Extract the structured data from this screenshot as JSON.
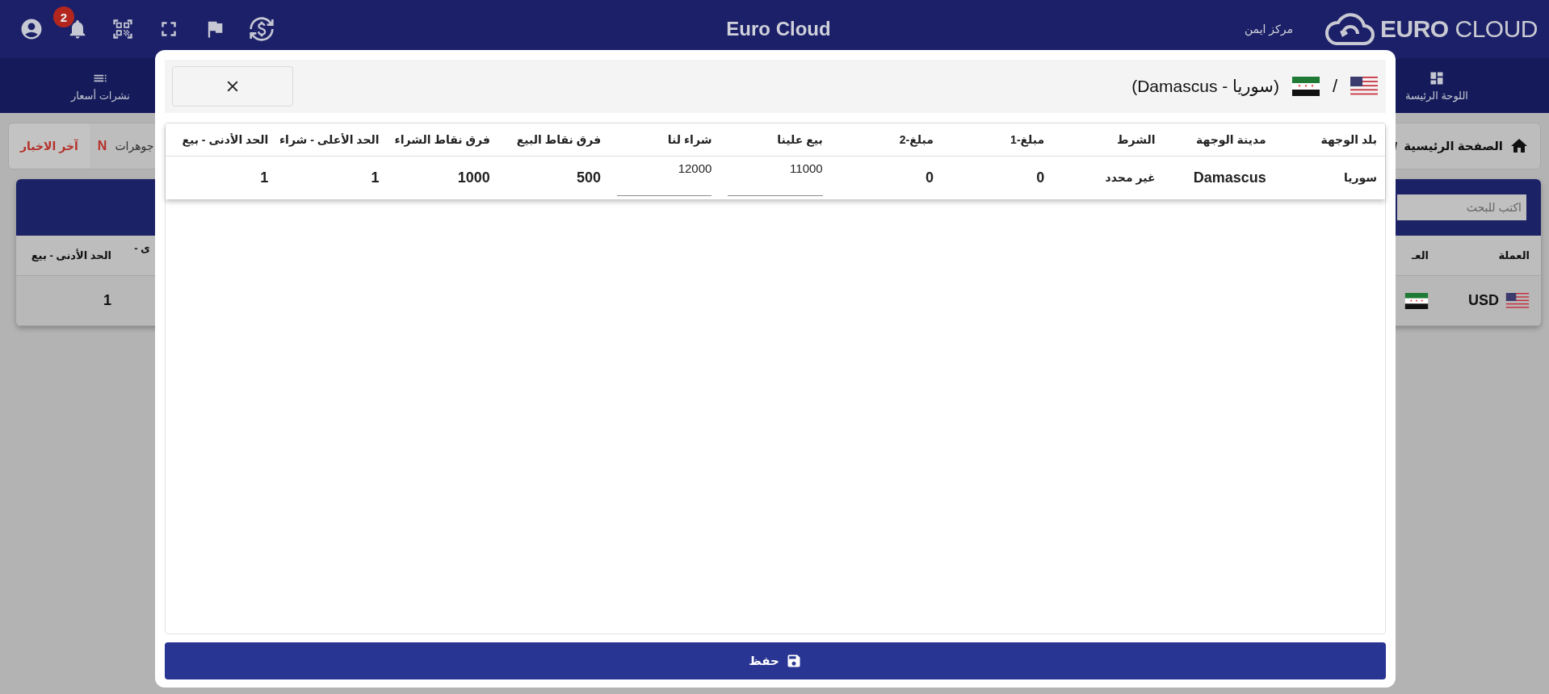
{
  "top_bar": {
    "notification_count": "2",
    "title": "Euro Cloud",
    "user_name": "مركز ايمن",
    "logo_text": "**EURO** CLOUD"
  },
  "nav": {
    "left_item": "نشرات أسعار",
    "right_item": "اللوحة الرئيسة"
  },
  "breadcrumb": {
    "home": "الصفحة الرئيسية",
    "separator": "/"
  },
  "news_ticker": {
    "label": "آخر الاخبار",
    "marker": "N",
    "headline": "جوهرات"
  },
  "currency_table": {
    "search": {
      "placeholder": "اكتب للبحث"
    },
    "right_columns": [
      "العملة",
      "العـ"
    ],
    "left_columns": [
      "ى -",
      "الحد الأدنى - بيع"
    ],
    "row": {
      "currency": "USD",
      "min_sell": "1"
    }
  },
  "dialog": {
    "title": "(سوريا - Damascus)",
    "separator": "/",
    "columns": [
      "بلد الوجهة",
      "مدينة الوجهة",
      "الشرط",
      "مبلغ-1",
      "مبلغ-2",
      "بيع علينا",
      "شراء لنا",
      "فرق نقاط البيع",
      "فرق نقاط الشراء",
      "الحد الأعلى - شراء",
      "الحد الأدنى - بيع"
    ],
    "rows": [
      {
        "cells": [
          {
            "kind": "label",
            "value": "سوريا"
          },
          {
            "kind": "value",
            "value": "Damascus"
          },
          {
            "kind": "label",
            "value": "غير محدد"
          },
          {
            "kind": "value",
            "value": "0"
          },
          {
            "kind": "value",
            "value": "0"
          },
          {
            "kind": "input",
            "value": "11000"
          },
          {
            "kind": "input",
            "value": "12000"
          },
          {
            "kind": "value",
            "value": "500"
          },
          {
            "kind": "value",
            "value": "1000"
          },
          {
            "kind": "value",
            "value": "1"
          },
          {
            "kind": "value",
            "value": "1"
          }
        ]
      }
    ],
    "save_button": "حفظ"
  }
}
